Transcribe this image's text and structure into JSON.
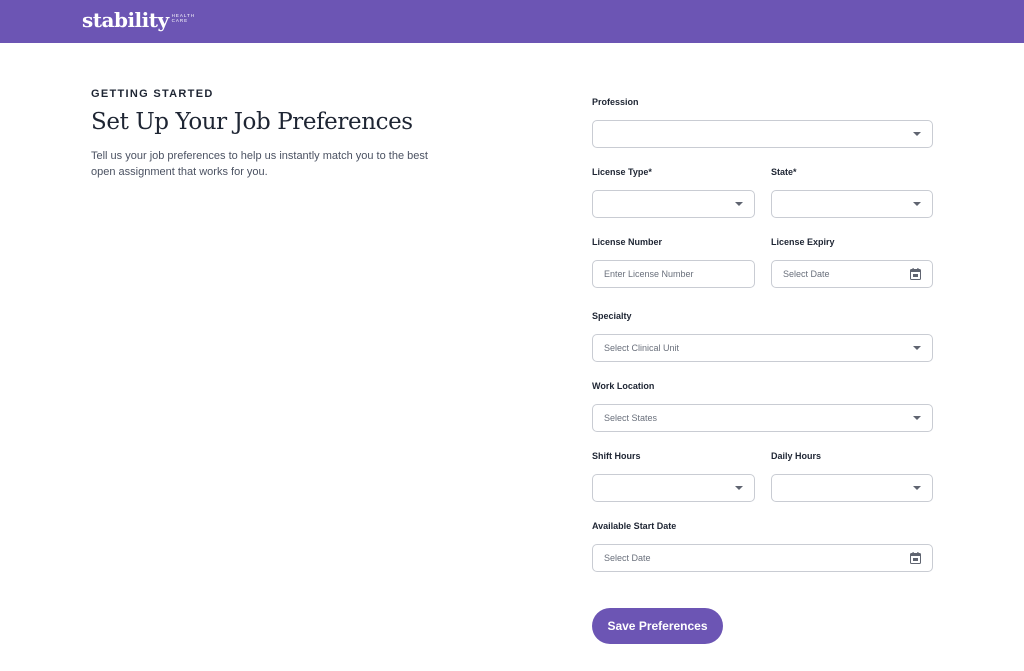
{
  "brand": {
    "name": "stability",
    "sub1": "HEALTH",
    "sub2": "CARE",
    "color": "#6c55b4"
  },
  "intro": {
    "eyebrow": "GETTING STARTED",
    "title": "Set Up Your Job Preferences",
    "description": "Tell us your job preferences to help us instantly match you to the best open assignment that works for you."
  },
  "form": {
    "profession": {
      "label": "Profession",
      "value": ""
    },
    "license_type": {
      "label": "License Type*",
      "value": ""
    },
    "state": {
      "label": "State*",
      "value": ""
    },
    "license_number": {
      "label": "License Number",
      "placeholder": "Enter License Number"
    },
    "license_expiry": {
      "label": "License Expiry",
      "placeholder": "Select Date",
      "icon": "calendar-icon"
    },
    "specialty": {
      "label": "Specialty",
      "placeholder": "Select Clinical Unit"
    },
    "work_location": {
      "label": "Work Location",
      "placeholder": "Select States"
    },
    "shift_hours": {
      "label": "Shift Hours",
      "value": ""
    },
    "daily_hours": {
      "label": "Daily Hours",
      "value": ""
    },
    "start_date": {
      "label": "Available Start Date",
      "placeholder": "Select Date",
      "icon": "calendar-icon"
    },
    "save_label": "Save Preferences"
  }
}
